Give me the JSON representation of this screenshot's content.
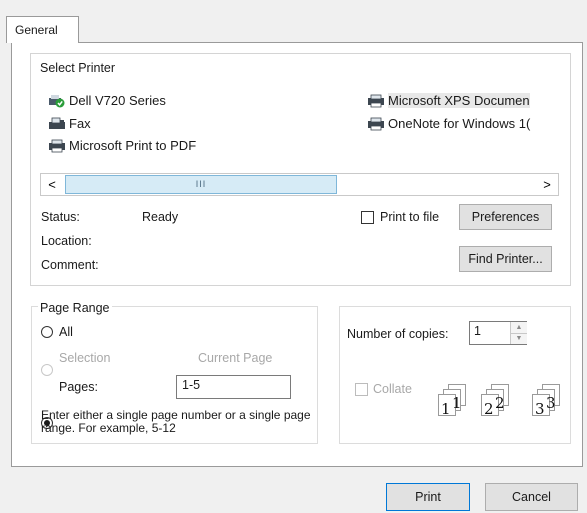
{
  "tabs": [
    {
      "label": "General"
    }
  ],
  "select_printer": {
    "label": "Select Printer",
    "printers": [
      {
        "name": "Dell V720 Series",
        "icon": "printer-default-icon"
      },
      {
        "name": "Fax",
        "icon": "fax-icon"
      },
      {
        "name": "Microsoft Print to PDF",
        "icon": "printer-icon"
      },
      {
        "name": "Microsoft XPS Documen",
        "icon": "printer-icon"
      },
      {
        "name": "OneNote for Windows 1(",
        "icon": "printer-icon"
      }
    ],
    "scroll_left": "<",
    "scroll_right": ">",
    "scroll_thumb_grip": "III"
  },
  "status": {
    "status_label": "Status:",
    "status_value": "Ready",
    "location_label": "Location:",
    "comment_label": "Comment:"
  },
  "print_to_file_label": "Print to file",
  "preferences_label": "Preferences",
  "find_printer_label": "Find Printer...",
  "page_range": {
    "label": "Page Range",
    "all_label": "All",
    "selection_label": "Selection",
    "current_page_label": "Current Page",
    "pages_label": "Pages:",
    "pages_value": "1-5",
    "hint": "Enter either a single page number or a single page range.  For example, 5-12"
  },
  "copies": {
    "label": "Number of copies:",
    "value": "1",
    "collate_label": "Collate",
    "collate_numbers": [
      "1",
      "1",
      "2",
      "2",
      "3",
      "3"
    ]
  },
  "footer": {
    "print_label": "Print",
    "cancel_label": "Cancel"
  }
}
